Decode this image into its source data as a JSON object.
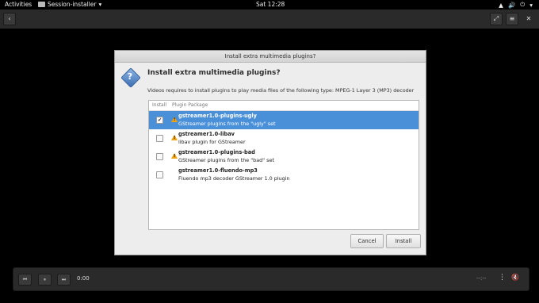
{
  "topbar": {
    "activities": "Activities",
    "app_name": "Session-installer",
    "app_arrow": "▾",
    "clock": "Sat 12:28",
    "wifi_icon": "▲",
    "volume_icon": "🔊",
    "power_icon": "⏻",
    "sys_arrow": "▾"
  },
  "headerbar": {
    "back_glyph": "‹",
    "fullscreen_glyph": "⤢",
    "menu_glyph": "≡",
    "close_glyph": "✕"
  },
  "dialog": {
    "title": "Install extra multimedia plugins?",
    "heading": "Install extra multimedia plugins?",
    "description": "Videos requires to install plugins to play media files of the following type: MPEG-1 Layer 3 (MP3) decoder",
    "columns": {
      "install": "Install",
      "package": "Plugin Package"
    },
    "rows": [
      {
        "name": "gstreamer1.0-plugins-ugly",
        "desc": "GStreamer plugins from the \"ugly\" set",
        "checked": "✔"
      },
      {
        "name": "gstreamer1.0-libav",
        "desc": "libav plugin for GStreamer",
        "checked": ""
      },
      {
        "name": "gstreamer1.0-plugins-bad",
        "desc": "GStreamer plugins from the \"bad\" set",
        "checked": ""
      },
      {
        "name": "gstreamer1.0-fluendo-mp3",
        "desc": "Fluendo mp3 decoder GStreamer 1.0 plugin",
        "checked": ""
      }
    ],
    "cancel": "Cancel",
    "install": "Install"
  },
  "player": {
    "prev_glyph": "⏮",
    "pause_glyph": "⏸",
    "next_glyph": "⏭",
    "time": "0:00",
    "remaining": "--:--",
    "more_glyph": "⋮",
    "volume_glyph": "🔇"
  },
  "colors": {
    "selection": "#4a90d9",
    "warning": "#f0a30a",
    "header": "#2a2a2a"
  }
}
